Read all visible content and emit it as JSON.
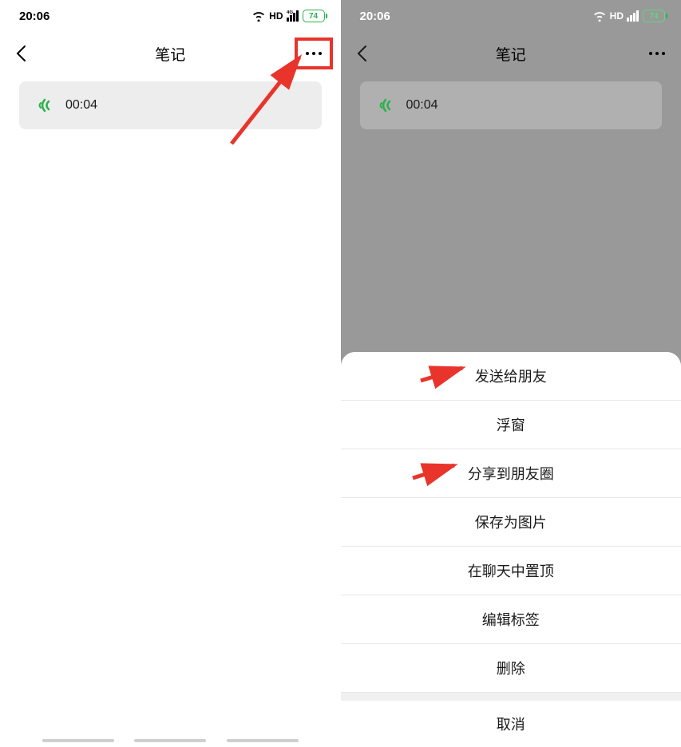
{
  "status": {
    "time": "20:06",
    "hd": "HD",
    "signal": "4G",
    "battery": "74"
  },
  "nav": {
    "title": "笔记"
  },
  "audio": {
    "duration": "00:04"
  },
  "sheet": {
    "items": [
      "发送给朋友",
      "浮窗",
      "分享到朋友圈",
      "保存为图片",
      "在聊天中置顶",
      "编辑标签",
      "删除"
    ],
    "cancel": "取消"
  }
}
